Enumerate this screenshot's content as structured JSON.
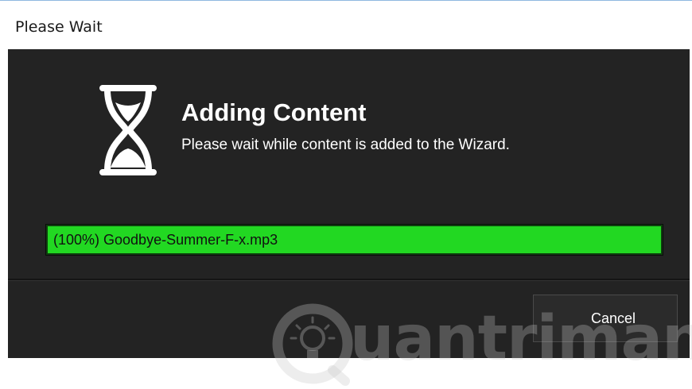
{
  "window": {
    "title": "Please Wait"
  },
  "status": {
    "heading": "Adding Content",
    "message": "Please wait while content is added to the Wizard.",
    "icon": "hourglass-icon"
  },
  "progress": {
    "label": "(100%) Goodbye-Summer-F-x.mp3",
    "percent": 100,
    "fill_color": "#22d822"
  },
  "buttons": {
    "cancel_label": "Cancel"
  },
  "watermark": {
    "text": "uantrimang",
    "icon": "lightbulb-icon"
  },
  "colors": {
    "client_background": "#232323",
    "progress_fill": "#22d822"
  }
}
